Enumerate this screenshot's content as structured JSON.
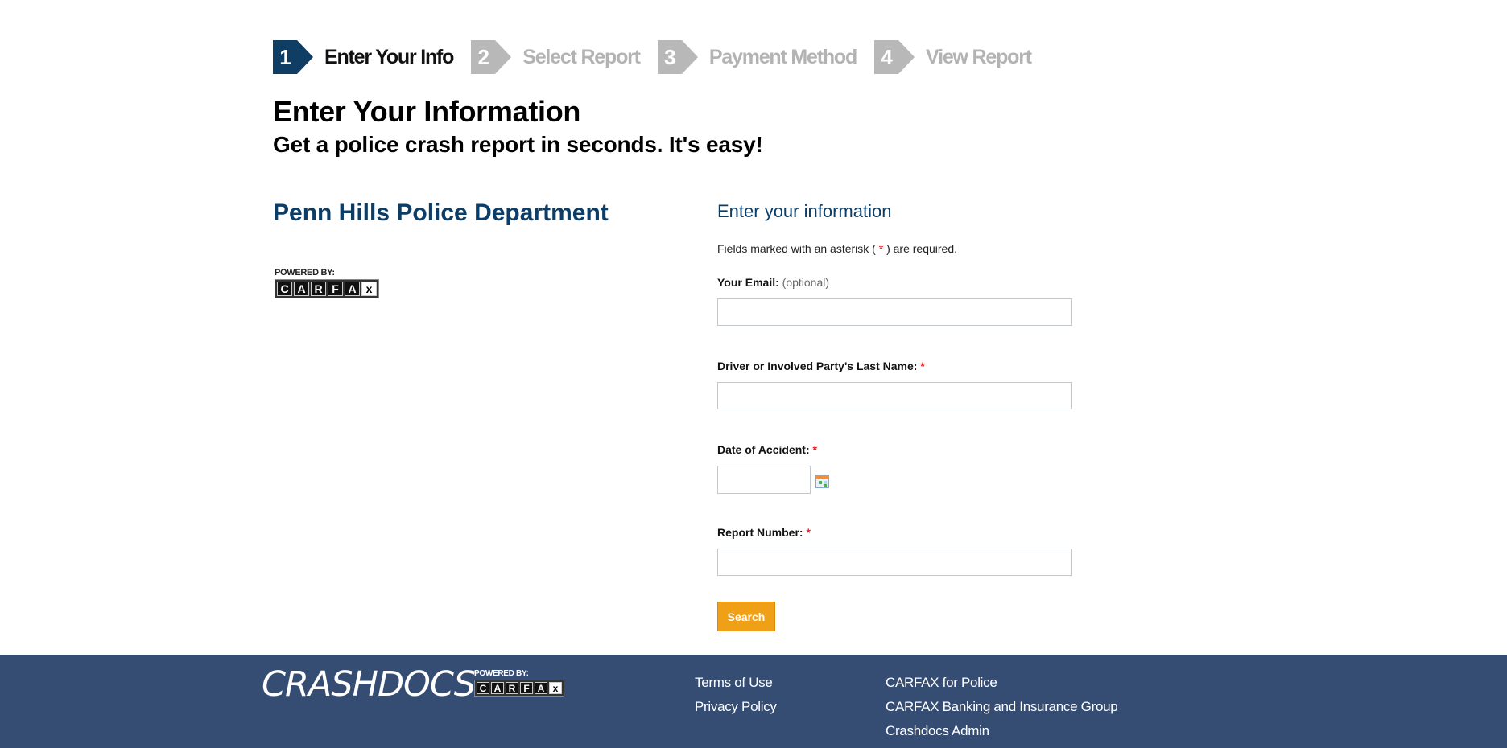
{
  "steps": [
    {
      "number": "1",
      "label": "Enter Your Info",
      "state": "active"
    },
    {
      "number": "2",
      "label": "Select Report",
      "state": "inactive"
    },
    {
      "number": "3",
      "label": "Payment Method",
      "state": "inactive"
    },
    {
      "number": "4",
      "label": "View Report",
      "state": "inactive"
    }
  ],
  "header": {
    "title": "Enter Your Information",
    "subtitle": "Get a police crash report in seconds. It's easy!"
  },
  "department": {
    "name": "Penn Hills Police Department",
    "powered_by": "POWERED BY:",
    "carfax_letters": [
      "C",
      "A",
      "R",
      "F",
      "A",
      "x"
    ]
  },
  "form": {
    "heading": "Enter your information",
    "required_note_prefix": "Fields marked with an asterisk ( ",
    "required_note_star": "*",
    "required_note_suffix": " ) are required.",
    "email": {
      "label": "Your Email:",
      "hint": "(optional)",
      "value": "",
      "placeholder": ""
    },
    "last_name": {
      "label": "Driver or Involved Party's Last Name:",
      "required": "*",
      "value": "",
      "placeholder": ""
    },
    "date": {
      "label": "Date of Accident:",
      "required": "*",
      "value": "",
      "placeholder": "",
      "icon": "calendar-icon"
    },
    "report_number": {
      "label": "Report Number:",
      "required": "*",
      "value": "",
      "placeholder": ""
    },
    "search_label": "Search"
  },
  "footer": {
    "logo_text": "CRASHDOCS",
    "powered_by": "POWERED BY:",
    "carfax_letters": [
      "C",
      "A",
      "R",
      "F",
      "A",
      "x"
    ],
    "links_col1": [
      "Terms of Use",
      "Privacy Policy"
    ],
    "links_col2": [
      "CARFAX for Police",
      "CARFAX Banking and Insurance Group",
      "Crashdocs Admin"
    ]
  },
  "colors": {
    "primary": "#0f3d63",
    "inactive_step": "#b8b8b8",
    "accent_button": "#f0a016",
    "footer_bg": "#354d73",
    "required": "#e02020"
  }
}
